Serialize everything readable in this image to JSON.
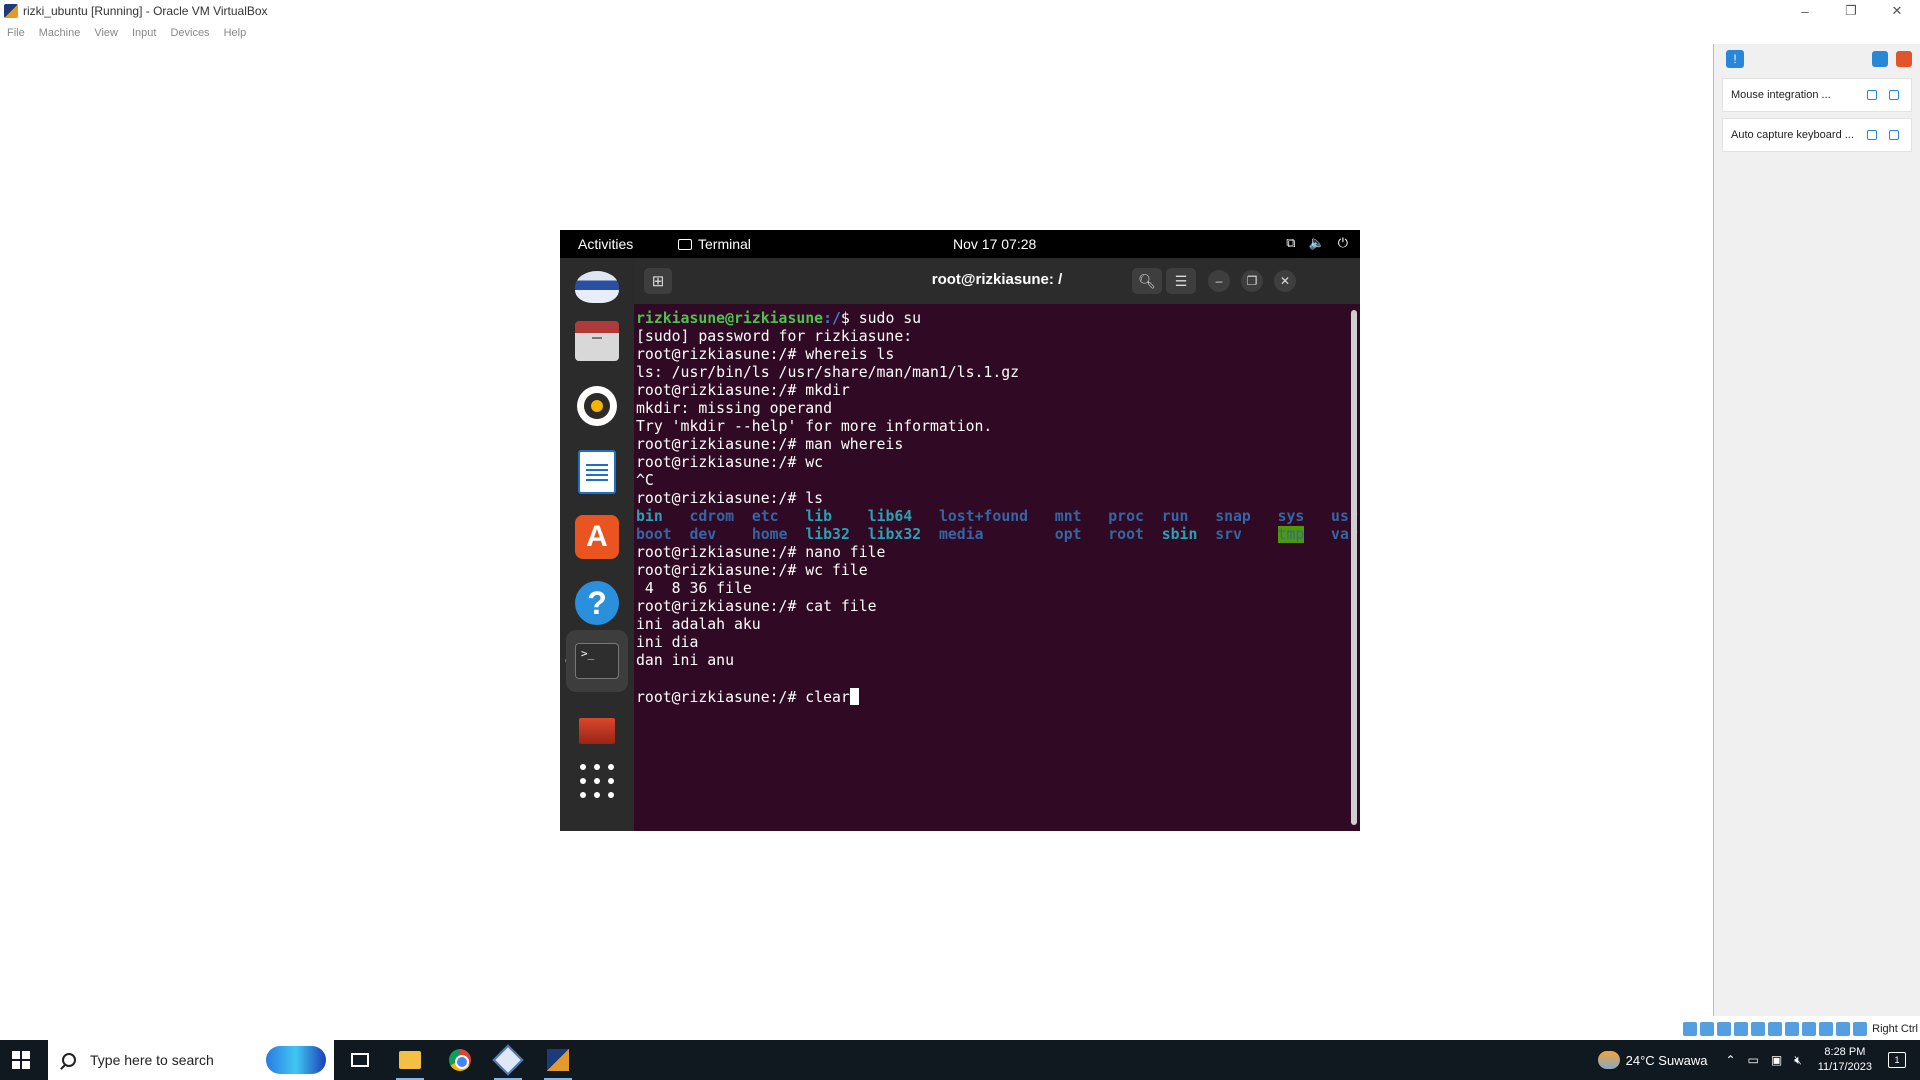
{
  "window": {
    "title": "rizki_ubuntu [Running] - Oracle VM VirtualBox",
    "controls": {
      "minimize": "–",
      "restore": "❐",
      "close": "✕"
    }
  },
  "menubar": [
    "File",
    "Machine",
    "View",
    "Input",
    "Devices",
    "Help"
  ],
  "guest": {
    "topbar": {
      "activities": "Activities",
      "app_name": "Terminal",
      "clock": "Nov 17  07:28",
      "status_icons": [
        "network-icon",
        "volume-icon",
        "power-icon"
      ]
    },
    "dock": [
      "thunderbird-icon",
      "files-icon",
      "rhythmbox-icon",
      "libreoffice-writer-icon",
      "app-center-icon",
      "help-icon",
      "terminal-icon",
      "trash-icon",
      "show-apps-icon"
    ],
    "terminal": {
      "title": "root@rizkiasune: /",
      "prompt_user": "rizkiasune@rizkiasune",
      "prompt_user_path": ":/",
      "root_prompt": "root@rizkiasune:/# ",
      "lines": [
        {
          "type": "user_cmd",
          "cmd": "$ sudo su"
        },
        {
          "type": "out",
          "text": "[sudo] password for rizkiasune:"
        },
        {
          "type": "root_cmd",
          "cmd": "whereis ls"
        },
        {
          "type": "out",
          "text": "ls: /usr/bin/ls /usr/share/man/man1/ls.1.gz"
        },
        {
          "type": "root_cmd",
          "cmd": "mkdir"
        },
        {
          "type": "out",
          "text": "mkdir: missing operand"
        },
        {
          "type": "out",
          "text": "Try 'mkdir --help' for more information."
        },
        {
          "type": "root_cmd",
          "cmd": "man whereis"
        },
        {
          "type": "root_cmd",
          "cmd": "wc"
        },
        {
          "type": "out",
          "text": "^C"
        },
        {
          "type": "root_cmd",
          "cmd": "ls"
        }
      ],
      "ls_row1": [
        "bin",
        "cdrom",
        "etc",
        "lib",
        "lib64",
        "lost+found",
        "mnt",
        "proc",
        "run",
        "snap",
        "sys",
        "usr"
      ],
      "ls_row2": [
        "boot",
        "dev",
        "home",
        "lib32",
        "libx32",
        "media",
        "",
        "opt",
        "root",
        "sbin",
        "srv",
        "tmp",
        "var"
      ],
      "lines_after": [
        {
          "type": "root_cmd",
          "cmd": "nano file"
        },
        {
          "type": "root_cmd",
          "cmd": "wc file"
        },
        {
          "type": "out",
          "text": " 4  8 36 file"
        },
        {
          "type": "root_cmd",
          "cmd": "cat file"
        },
        {
          "type": "out",
          "text": "ini adalah aku"
        },
        {
          "type": "out",
          "text": "ini dia"
        },
        {
          "type": "out",
          "text": "dan ini anu"
        },
        {
          "type": "out",
          "text": ""
        },
        {
          "type": "root_cmd",
          "cmd": "clear"
        }
      ]
    }
  },
  "notifications": [
    {
      "text": "Mouse integration ..."
    },
    {
      "text": "Auto capture keyboard ..."
    }
  ],
  "status_bar": {
    "host_key": "Right Ctrl"
  },
  "taskbar": {
    "search_placeholder": "Type here to search",
    "weather": "24°C  Suwawa",
    "time": "8:28 PM",
    "date": "11/17/2023",
    "notification_count": "1"
  }
}
